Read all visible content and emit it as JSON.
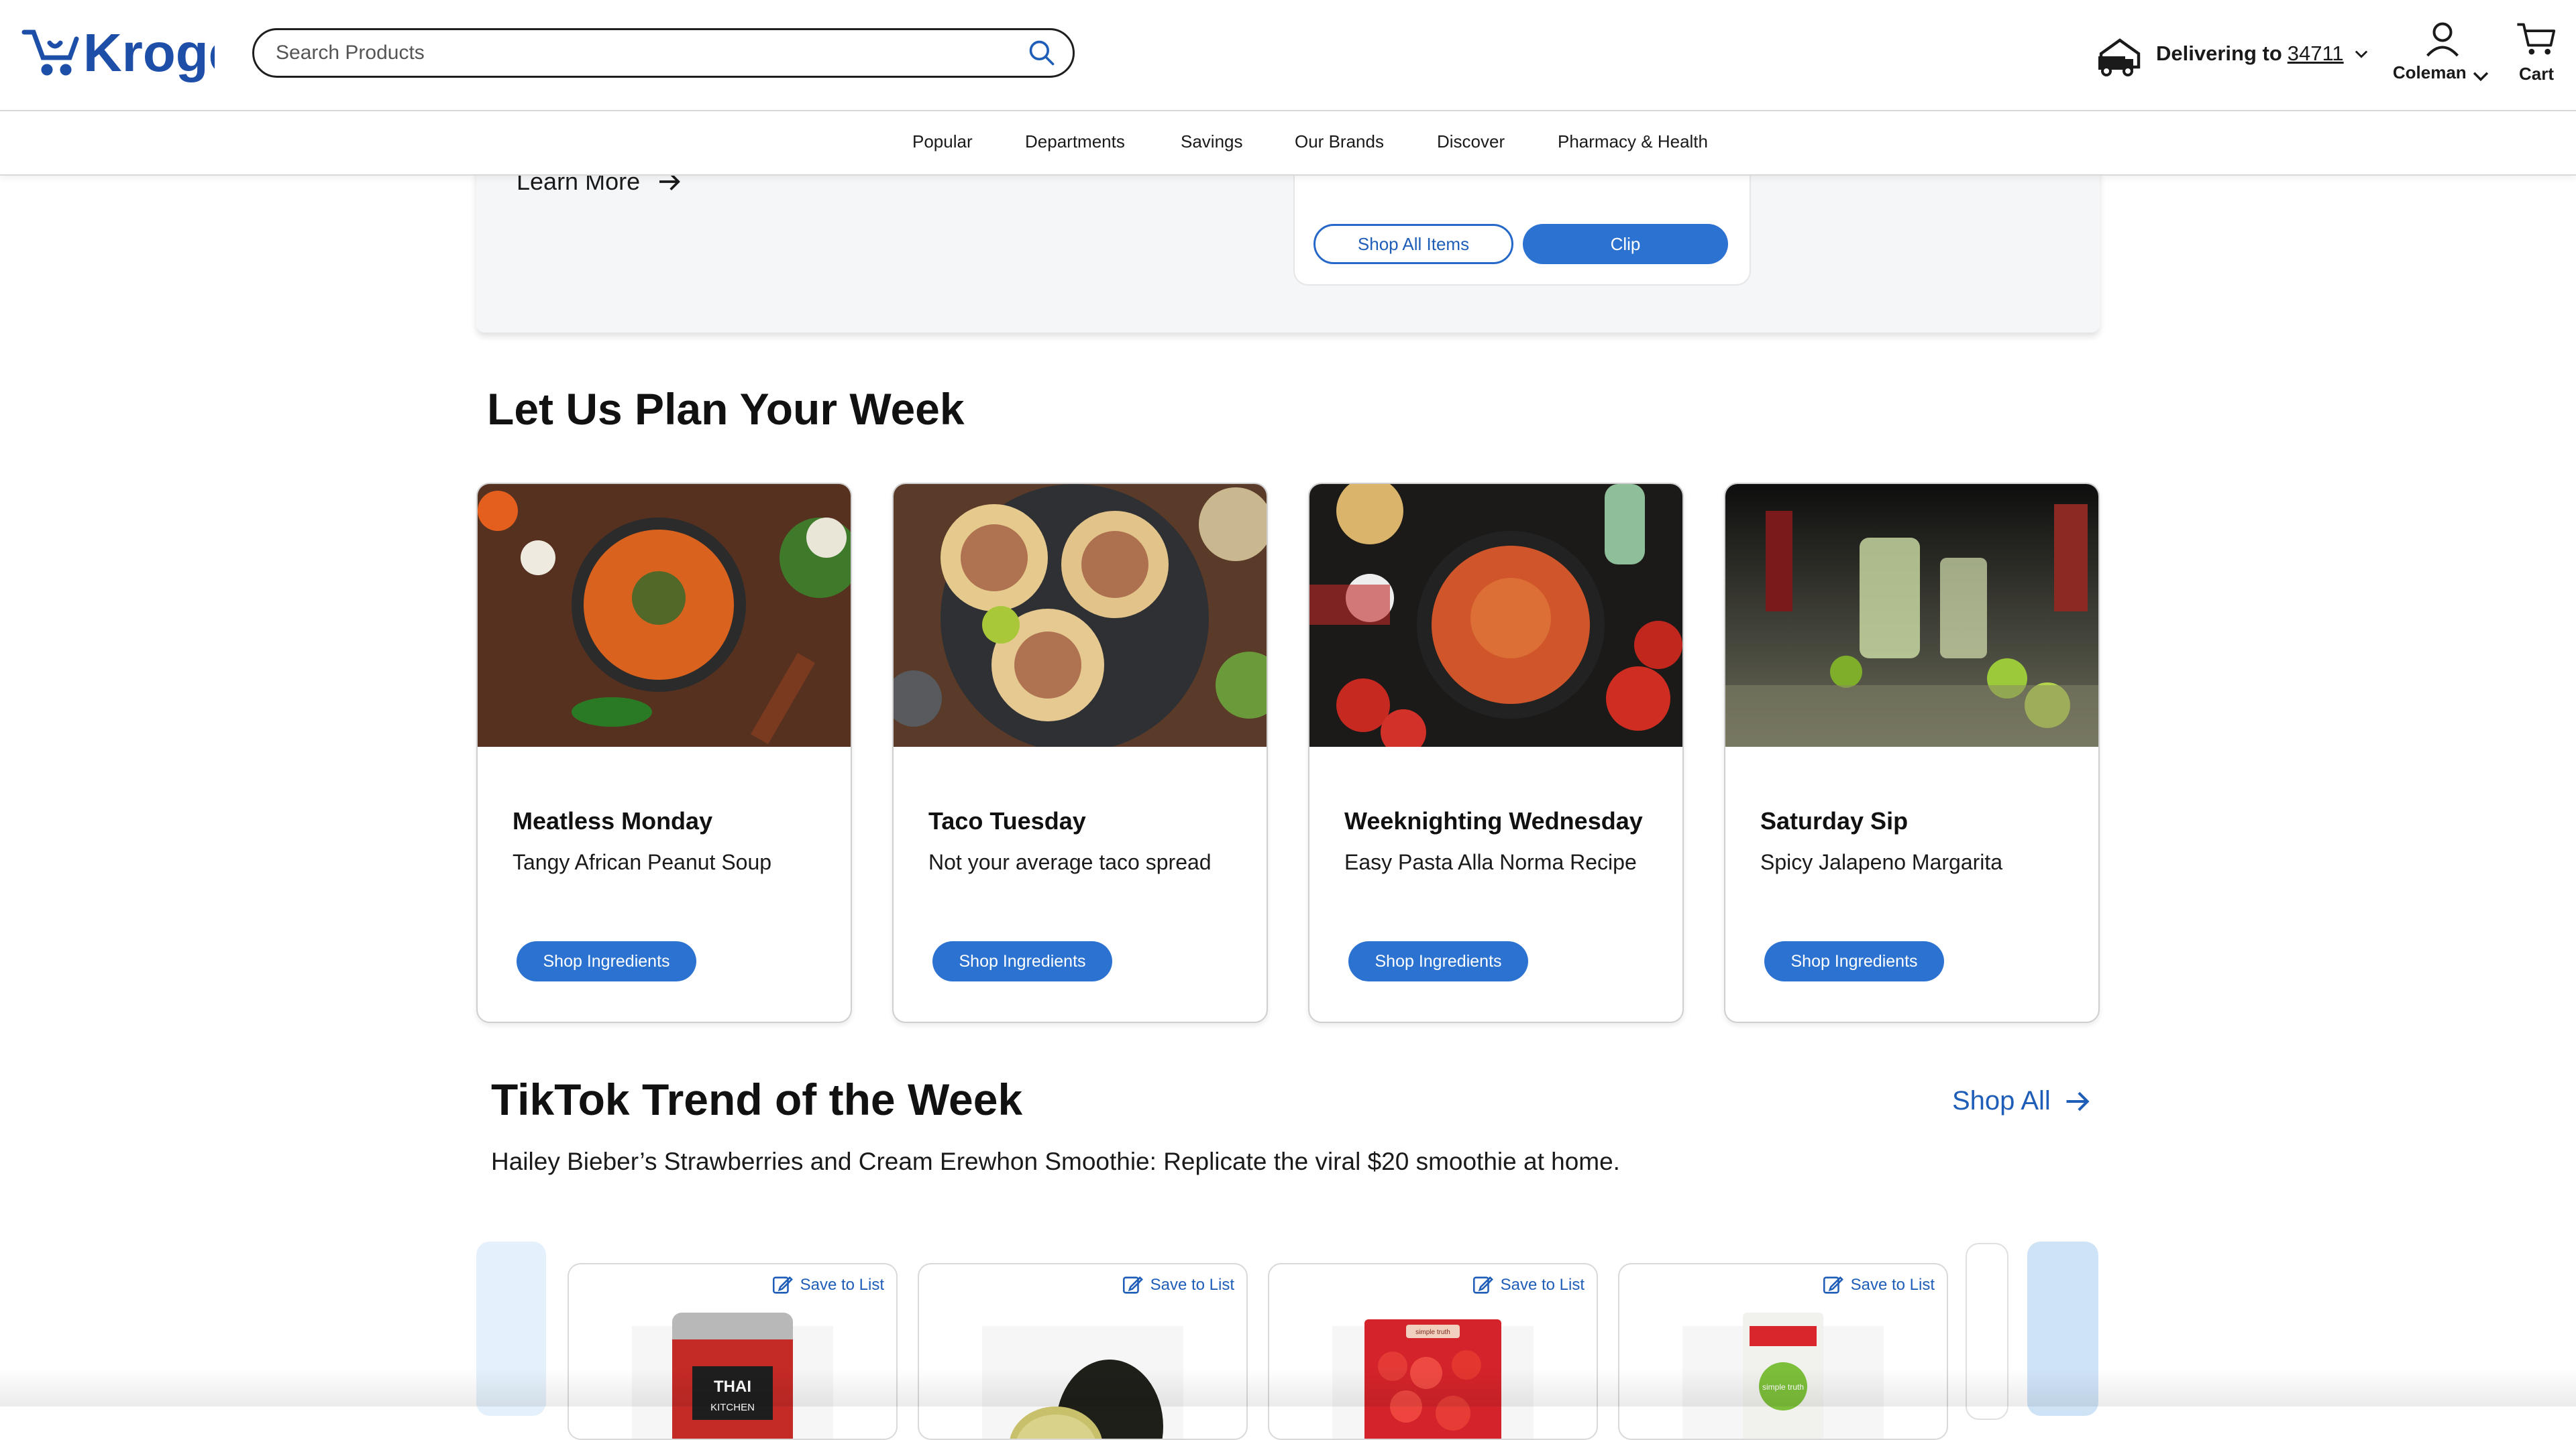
{
  "header": {
    "logo_text": "Kroger",
    "search": {
      "placeholder": "Search Products"
    },
    "delivery": {
      "label": "Delivering to",
      "zip": "34711"
    },
    "account": {
      "label": "Coleman"
    },
    "cart": {
      "label": "Cart"
    }
  },
  "nav": {
    "items": [
      {
        "label": "Popular"
      },
      {
        "label": "Departments"
      },
      {
        "label": "Savings"
      },
      {
        "label": "Our Brands"
      },
      {
        "label": "Discover"
      },
      {
        "label": "Pharmacy & Health"
      }
    ]
  },
  "promo": {
    "learn_more": "Learn More",
    "shop_all_items": "Shop All Items",
    "clip": "Clip"
  },
  "plan": {
    "heading": "Let Us Plan Your Week",
    "cards": [
      {
        "title": "Meatless Monday",
        "subtitle": "Tangy African Peanut Soup",
        "button": "Shop Ingredients"
      },
      {
        "title": "Taco Tuesday",
        "subtitle": "Not your average taco spread",
        "button": "Shop Ingredients"
      },
      {
        "title": "Weeknighting Wednesday",
        "subtitle": "Easy Pasta Alla Norma Recipe",
        "button": "Shop Ingredients"
      },
      {
        "title": "Saturday Sip",
        "subtitle": "Spicy Jalapeno Margarita",
        "button": "Shop Ingredients"
      }
    ]
  },
  "tiktok": {
    "heading": "TikTok Trend of the Week",
    "shop_all": "Shop All",
    "description": "Hailey Bieber’s Strawberries and Cream Erewhon Smoothie: Replicate the viral $20 smoothie at home.",
    "products": [
      {
        "save_label": "Save to List",
        "image_text": "THAI KITCHEN"
      },
      {
        "save_label": "Save to List"
      },
      {
        "save_label": "Save to List",
        "image_text": "simple truth"
      },
      {
        "save_label": "Save to List",
        "image_text": "simple truth"
      }
    ]
  },
  "colors": {
    "brand_blue": "#2b72d1",
    "link_blue": "#1f5eb8",
    "kroger_logo": "#1e4fa8"
  }
}
